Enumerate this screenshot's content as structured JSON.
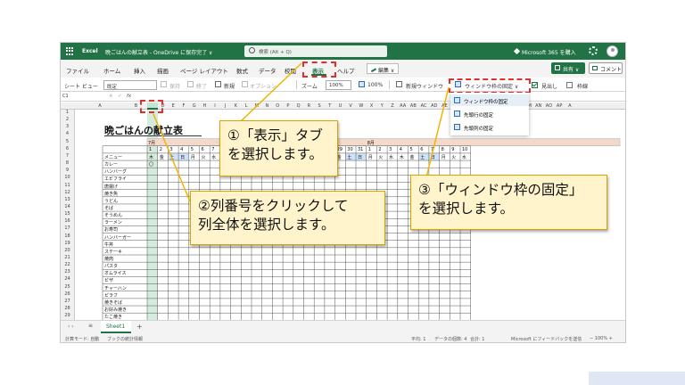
{
  "titlebar": {
    "app": "Excel",
    "doc": "晩ごはんの献立表 - OneDrive に保存完了 ∨",
    "search_placeholder": "検索 (Alt + Q)",
    "m365": "Microsoft 365 を購入"
  },
  "menu": {
    "tabs": [
      "ファイル",
      "ホーム",
      "挿入",
      "描画",
      "ページ レイアウト",
      "数式",
      "データ",
      "校閲",
      "表示",
      "ヘルプ"
    ],
    "editing": "編集 ∨",
    "share": "共有 ∨",
    "comment": "コメント"
  },
  "ribbon": {
    "sheet_view": "シート ビュー",
    "view_value": "既定",
    "keep": "保持",
    "exit": "終了",
    "new": "新規",
    "options": "オプション",
    "zoom": "ズーム",
    "zoom_value": "100%",
    "zoom_100": "100%",
    "new_window": "新規ウィンドウ",
    "freeze_panes": "ウィンドウ枠の固定 ∨",
    "headings": "見出し",
    "gridlines": "枠線"
  },
  "dropdown": {
    "items": [
      "ウィンドウ枠の固定",
      "先頭行の固定",
      "先頭列の固定"
    ]
  },
  "formulabar": {
    "namebox": "C1",
    "x": "×",
    "check": "✓",
    "fx": "fx"
  },
  "columns": [
    "A",
    "B",
    "C",
    "D",
    "E",
    "F",
    "G",
    "H",
    "I",
    "J",
    "K",
    "L",
    "M",
    "N",
    "O",
    "P",
    "Q",
    "R",
    "S",
    "T",
    "U",
    "V",
    "W",
    "X",
    "Y",
    "Z",
    "AA",
    "AB",
    "AC",
    "AD",
    "AE",
    "AF",
    "AG",
    "AH",
    "AI",
    "AJ",
    "AK",
    "AL",
    "AM",
    "AN",
    "AO",
    "AP",
    "A"
  ],
  "rows": [
    "1",
    "2",
    "3",
    "4",
    "5",
    "6",
    "7",
    "8",
    "9",
    "10",
    "11",
    "12",
    "13",
    "14",
    "15",
    "16",
    "17",
    "18",
    "19",
    "20",
    "21",
    "22",
    "23",
    "24",
    "25",
    "26",
    "27",
    "28",
    "29"
  ],
  "sheet": {
    "title": "晩ごはんの献立表",
    "month1": "7月",
    "month2": "8月",
    "menu_label": "メニュー",
    "days_left": [
      "1",
      "2",
      "3",
      "4",
      "5",
      "6",
      "7"
    ],
    "dow_left": [
      "木",
      "金",
      "土",
      "日",
      "月",
      "火",
      "水"
    ],
    "days_mid": [
      "18",
      "19",
      "20",
      "21",
      "22",
      "23",
      "24",
      "25",
      "26",
      "27",
      "28",
      "29",
      "30",
      "31"
    ],
    "dow_mid": [
      "月",
      "火",
      "水",
      "木",
      "金",
      "土",
      "日",
      "月",
      "火",
      "水",
      "木",
      "金",
      "土",
      "日"
    ],
    "days_right": [
      "1",
      "2",
      "3",
      "4",
      "5",
      "6",
      "7",
      "8",
      "9",
      "10"
    ],
    "dow_right": [
      "月",
      "火",
      "水",
      "木",
      "金",
      "土",
      "日",
      "月",
      "火",
      "水"
    ],
    "mark": "〇",
    "items": [
      "カレー",
      "ハンバーグ",
      "エビフライ",
      "唐揚げ",
      "焼き魚",
      "うどん",
      "そば",
      "そうめん",
      "ラーメン",
      "お寿司",
      "ハンバーガー",
      "牛丼",
      "ステーキ",
      "焼肉",
      "パスタ",
      "オムライス",
      "ピザ",
      "チャーハン",
      "ピラフ",
      "焼きそば",
      "お好み焼き",
      "たこ焼き"
    ]
  },
  "sheetbar": {
    "tab": "Sheet1",
    "add": "+"
  },
  "status": {
    "calc": "計算モード: 自動",
    "stats": "ブックの統計情報",
    "avg": "平均: 1",
    "count": "データの個数: 4",
    "sum": "合計: 1",
    "feedback": "Microsoft にフィードバックを送信",
    "zoom": "−  100%  +"
  },
  "callouts": {
    "c1_line1": "①「表示」タブ",
    "c1_line2": "を選択します。",
    "c2_line1": "②列番号をクリックして",
    "c2_line2": "列全体を選択します。",
    "c3_line1": "③「ウィンドウ枠の固定」",
    "c3_line2": "を選択します。"
  },
  "colors": {
    "excel_green": "#217346",
    "highlight_red": "#e52d2d",
    "callout_bg": "#fff4cc",
    "callout_border": "#d8a400",
    "weekend_blue": "#cfe3f7",
    "month_bar": "#f3d9c9"
  }
}
